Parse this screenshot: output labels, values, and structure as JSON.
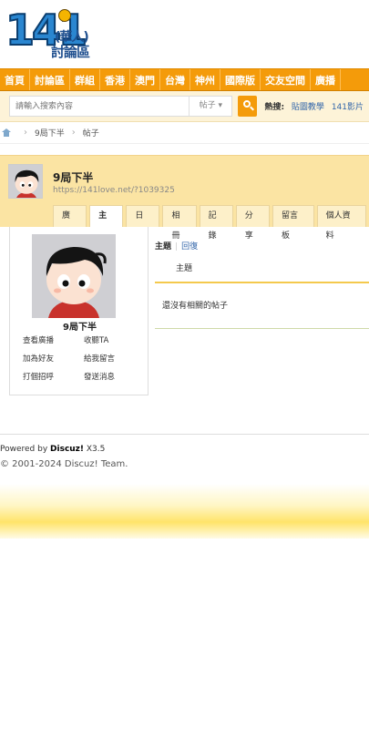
{
  "logo": {
    "number": "141",
    "line1": "(華人)",
    "line2": "討論區"
  },
  "nav": {
    "items": [
      "首頁",
      "討論區",
      "群組",
      "香港",
      "澳門",
      "台灣",
      "神州",
      "國際版",
      "交友空間",
      "廣播"
    ]
  },
  "search": {
    "placeholder": "請輸入搜索內容",
    "scope": "帖子 ▾",
    "hot_label": "熱搜:",
    "hot_items": [
      "貼圖教學",
      "141影片"
    ]
  },
  "breadcrumb": {
    "items": [
      "9局下半",
      "帖子"
    ]
  },
  "profile": {
    "name": "9局下半",
    "url": "https://141love.net/?1039325",
    "tabs": [
      "廣播",
      "主題",
      "日誌",
      "相冊",
      "記錄",
      "分享",
      "留言板",
      "個人資料"
    ],
    "active_tab": "主題"
  },
  "card": {
    "name": "9局下半",
    "links": [
      "查看廣播",
      "收聽TA",
      "加為好友",
      "給我留言",
      "打個招呼",
      "發送消息"
    ]
  },
  "threads": {
    "subtab_topic": "主題",
    "subtab_reply": "回復",
    "column_header": "主題",
    "empty_text": "還沒有相關的帖子"
  },
  "footer": {
    "powered_prefix": "Powered by ",
    "powered_brand": "Discuz!",
    "powered_version": " X3.5",
    "copyright": "© 2001-2024 Discuz! Team."
  }
}
